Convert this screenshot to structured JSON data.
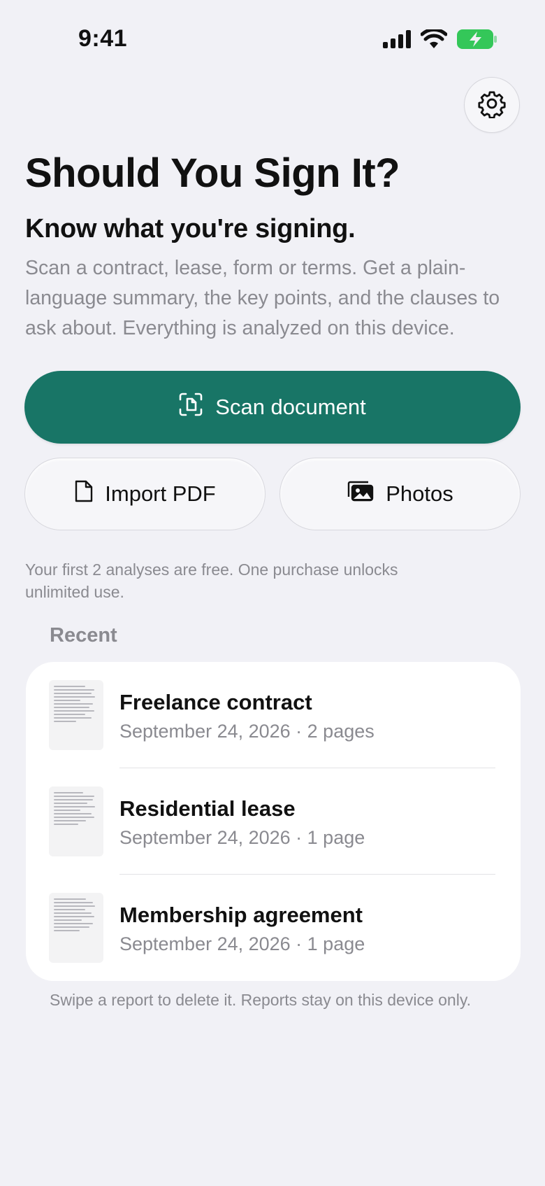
{
  "status_bar": {
    "time": "9:41"
  },
  "header": {
    "title": "Should You Sign It?",
    "subtitle": "Know what you're signing.",
    "description": "Scan a contract, lease, form or terms. Get a plain-language summary, the key points, and the clauses to ask about. Everything is analyzed on this device."
  },
  "actions": {
    "scan_label": "Scan document",
    "import_label": "Import PDF",
    "photos_label": "Photos"
  },
  "free_note": "Your first 2 analyses are free. One purchase unlocks unlimited use.",
  "recent": {
    "header": "Recent",
    "items": [
      {
        "title": "Freelance contract",
        "meta": "September 24, 2026 · 2 pages"
      },
      {
        "title": "Residential lease",
        "meta": "September 24, 2026 · 1 page"
      },
      {
        "title": "Membership agreement",
        "meta": "September 24, 2026 · 1 page"
      }
    ]
  },
  "footer_note": "Swipe a report to delete it. Reports stay on this device only.",
  "icons": [
    "signal-icon",
    "wifi-icon",
    "battery-icon",
    "gear-icon",
    "scan-icon",
    "document-icon",
    "photos-icon"
  ],
  "colors": {
    "accent": "#187566",
    "background": "#f1f1f6",
    "battery": "#34c759"
  }
}
